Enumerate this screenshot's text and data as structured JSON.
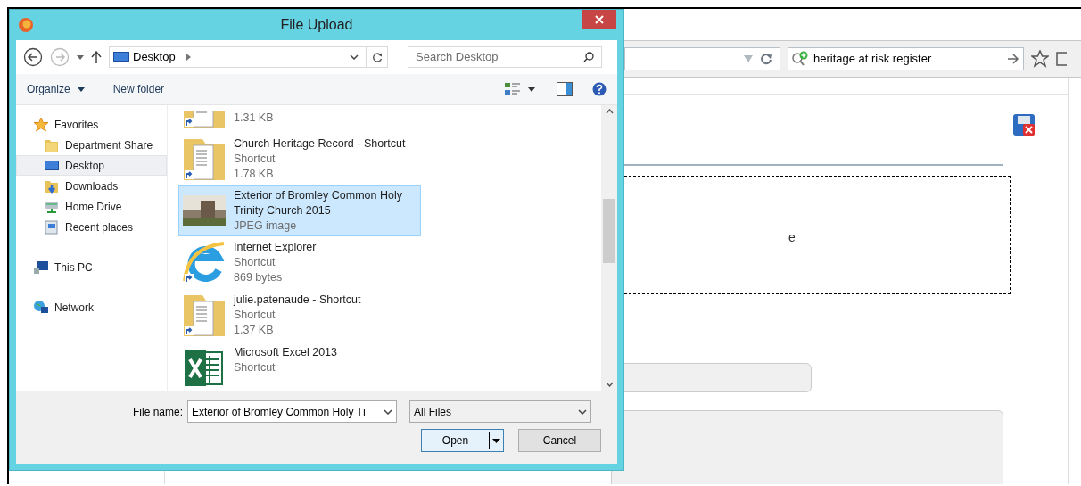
{
  "browser": {
    "search_text": "heritage at risk register",
    "page_fragment": "e"
  },
  "dialog": {
    "title": "File Upload",
    "location": "Desktop",
    "search_placeholder": "Search Desktop",
    "commands": [
      {
        "label": "Organize",
        "kind": "menu"
      },
      {
        "label": "New folder",
        "kind": "plain"
      }
    ],
    "nav": [
      {
        "label": "Favorites",
        "kind": "star",
        "children": [
          {
            "label": "Department Share",
            "kind": "folder",
            "selected": false
          },
          {
            "label": "Desktop",
            "kind": "desktop",
            "selected": true
          },
          {
            "label": "Downloads",
            "kind": "downloads",
            "selected": false
          },
          {
            "label": "Home Drive",
            "kind": "drive",
            "selected": false
          },
          {
            "label": "Recent places",
            "kind": "recent",
            "selected": false
          }
        ]
      },
      {
        "label": "This PC",
        "kind": "pc"
      },
      {
        "label": "Network",
        "kind": "network"
      }
    ],
    "files": [
      {
        "lines": [
          "1.31 KB"
        ],
        "kind": "folder-shortcut",
        "selected": false
      },
      {
        "name": "Church Heritage Record - Shortcut",
        "lines": [
          "Shortcut",
          "1.78 KB"
        ],
        "kind": "folder-shortcut",
        "selected": false
      },
      {
        "name": "Exterior of Bromley Common Holy Trinity Church 2015",
        "lines": [
          "JPEG image"
        ],
        "kind": "photo",
        "selected": true
      },
      {
        "name": "Internet Explorer",
        "lines": [
          "Shortcut",
          "869 bytes"
        ],
        "kind": "browser",
        "selected": false
      },
      {
        "name": "julie.patenaude - Shortcut",
        "lines": [
          "Shortcut",
          "1.37 KB"
        ],
        "kind": "folder-shortcut",
        "selected": false
      },
      {
        "name": "Microsoft Excel 2013",
        "lines": [
          "Shortcut"
        ],
        "kind": "spreadsheet",
        "selected": false
      }
    ],
    "file_name_label": "File name:",
    "file_name": "Exterior of Bromley Common Holy Tı",
    "file_type": "All Files",
    "buttons": [
      {
        "label": "Open",
        "kind": "split"
      },
      {
        "label": "Cancel",
        "kind": "plain"
      }
    ]
  }
}
